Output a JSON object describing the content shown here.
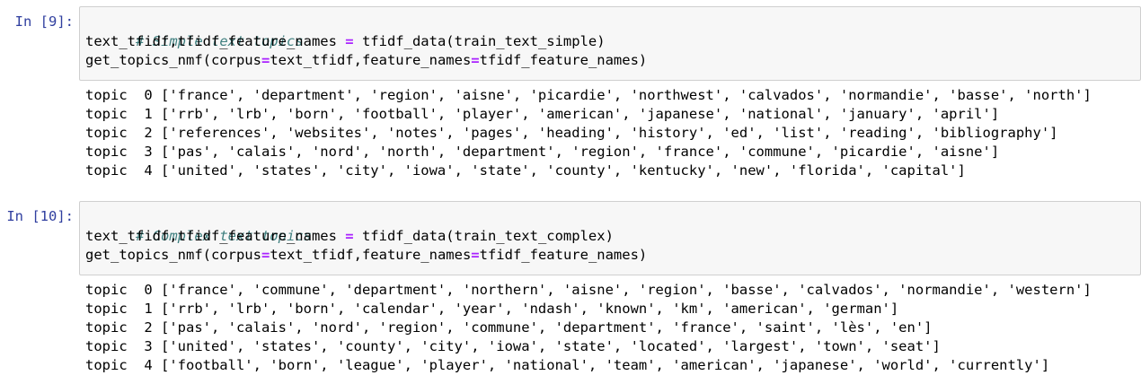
{
  "cells": [
    {
      "prompt": "In [9]:",
      "comment": "# Simple text topics",
      "line2": {
        "lhs": "text_tfidf,tfidf_feature_names ",
        "eq": "=",
        "rhs": " tfidf_data(train_text_simple)"
      },
      "line3": {
        "a": "get_topics_nmf(corpus",
        "eq1": "=",
        "b": "text_tfidf,feature_names",
        "eq2": "=",
        "c": "tfidf_feature_names)"
      },
      "output": [
        "topic  0 ['france', 'department', 'region', 'aisne', 'picardie', 'northwest', 'calvados', 'normandie', 'basse', 'north']",
        "topic  1 ['rrb', 'lrb', 'born', 'football', 'player', 'american', 'japanese', 'national', 'january', 'april']",
        "topic  2 ['references', 'websites', 'notes', 'pages', 'heading', 'history', 'ed', 'list', 'reading', 'bibliography']",
        "topic  3 ['pas', 'calais', 'nord', 'north', 'department', 'region', 'france', 'commune', 'picardie', 'aisne']",
        "topic  4 ['united', 'states', 'city', 'iowa', 'state', 'county', 'kentucky', 'new', 'florida', 'capital']"
      ]
    },
    {
      "prompt": "In [10]:",
      "comment": "# Complex text topics",
      "line2": {
        "lhs": "text_tfidf,tfidf_feature_names ",
        "eq": "=",
        "rhs": " tfidf_data(train_text_complex)"
      },
      "line3": {
        "a": "get_topics_nmf(corpus",
        "eq1": "=",
        "b": "text_tfidf,feature_names",
        "eq2": "=",
        "c": "tfidf_feature_names)"
      },
      "output": [
        "topic  0 ['france', 'commune', 'department', 'northern', 'aisne', 'region', 'basse', 'calvados', 'normandie', 'western']",
        "topic  1 ['rrb', 'lrb', 'born', 'calendar', 'year', 'ndash', 'known', 'km', 'american', 'german']",
        "topic  2 ['pas', 'calais', 'nord', 'region', 'commune', 'department', 'france', 'saint', 'lès', 'en']",
        "topic  3 ['united', 'states', 'county', 'city', 'iowa', 'state', 'located', 'largest', 'town', 'seat']",
        "topic  4 ['football', 'born', 'league', 'player', 'national', 'team', 'american', 'japanese', 'world', 'currently']"
      ]
    }
  ]
}
